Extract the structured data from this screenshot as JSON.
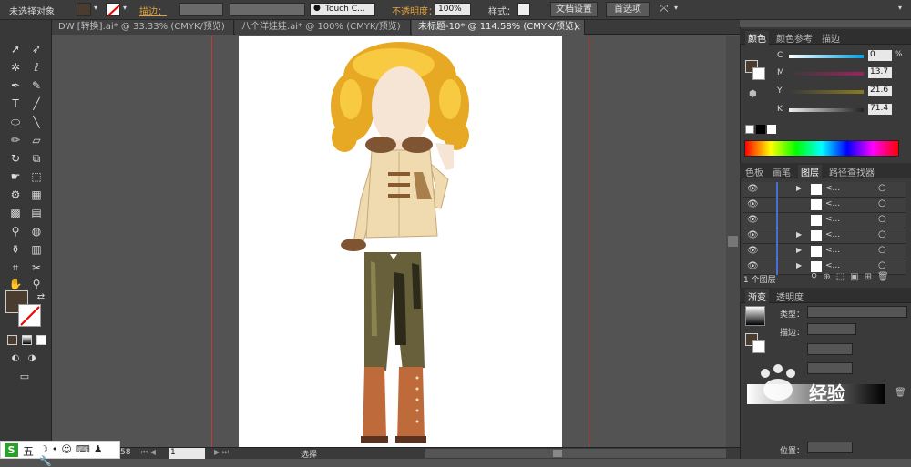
{
  "control_bar": {
    "selection_label": "未选择对象",
    "stroke_label": "描边：",
    "brush_label": "Touch C...",
    "opacity_label": "不透明度：",
    "opacity_value": "100%",
    "style_label": "样式：",
    "doc_setup_button": "文档设置",
    "prefs_button": "首选项"
  },
  "tabs": [
    {
      "label": "DW [转换].ai* @ 33.33% (CMYK/预览)"
    },
    {
      "label": "八个洋娃娃.ai* @ 100% (CMYK/预览)"
    },
    {
      "label": "未标题-10* @ 114.58% (CMYK/预览)"
    }
  ],
  "tab_close": "×",
  "panels": {
    "color_tabs": [
      "颜色",
      "颜色参考",
      "描边"
    ],
    "cmyk": [
      {
        "ch": "C",
        "value": "0"
      },
      {
        "ch": "M",
        "value": "13.7"
      },
      {
        "ch": "Y",
        "value": "21.6"
      },
      {
        "ch": "K",
        "value": "71.4"
      }
    ],
    "pct": "%",
    "layer_tabs": [
      "色板",
      "画笔",
      "图层",
      "路径查找器"
    ],
    "layer_rows": [
      "<...",
      "<...",
      "<...",
      "<...",
      "<...",
      "<..."
    ],
    "layer_count": "1 个图层",
    "gradient_tabs": [
      "渐变",
      "透明度"
    ],
    "gradient_type_label": "类型：",
    "gradient_stroke_label": "描边：",
    "gradient_position_label": "位置："
  },
  "status": {
    "zoom": "58",
    "page": "1",
    "tool": "选择"
  },
  "colors": {
    "fill": "#4a3d30",
    "accent": "#d6a23a"
  },
  "watermark": "经验",
  "ime": {
    "label": "五"
  }
}
